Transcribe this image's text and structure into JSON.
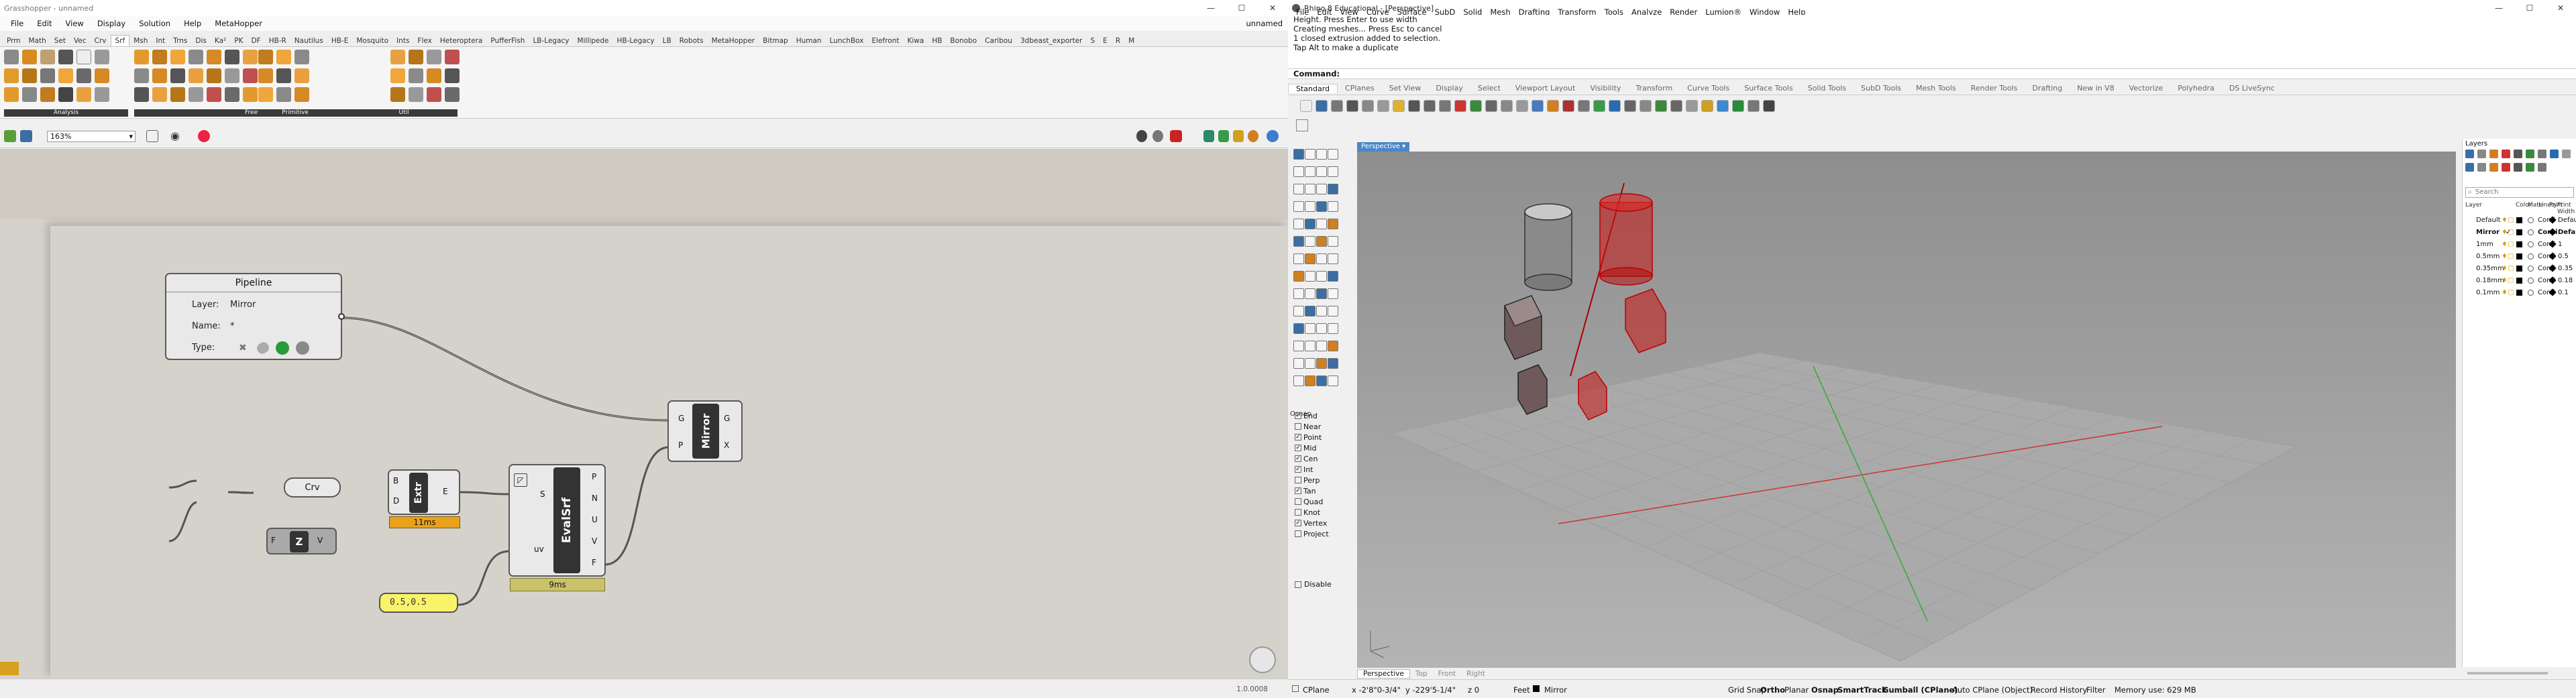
{
  "grasshopper": {
    "title": "Grasshopper - unnamed",
    "doc_name": "unnamed",
    "menu": [
      "File",
      "Edit",
      "View",
      "Display",
      "Solution",
      "Help",
      "MetaHopper"
    ],
    "tabs": [
      "Prm",
      "Math",
      "Set",
      "Vec",
      "Crv",
      "Srf",
      "Msh",
      "Int",
      "Trns",
      "Dis",
      "Ka²",
      "PK",
      "DF",
      "HB-R",
      "Nautilus",
      "HB-E",
      "Mosquito",
      "Ints",
      "Flex",
      "Heteroptera",
      "PufferFish",
      "LB-Legacy",
      "Millipede",
      "HB-Legacy",
      "LB",
      "Robots",
      "MetaHopper",
      "Bitmap",
      "Human",
      "LunchBox",
      "Elefront",
      "Kiwa",
      "HB",
      "Bonobo",
      "Caribou",
      "3dbeast_exporter",
      "S",
      "E",
      "R",
      "M"
    ],
    "active_tab": "Srf",
    "panel_labels": [
      "Analysis",
      "Freeform",
      "Primitive",
      "SubD",
      "Util"
    ],
    "zoom": "163%",
    "nodes": {
      "pipeline": {
        "title": "Pipeline",
        "layer_label": "Layer:",
        "layer_value": "Mirror",
        "name_label": "Name:",
        "name_value": "*",
        "type_label": "Type:"
      },
      "crv": {
        "label": "Crv"
      },
      "z": {
        "label": "Z",
        "in": "F",
        "out": "V"
      },
      "extr": {
        "label": "Extr",
        "in1": "B",
        "in2": "D",
        "out": "E",
        "timing": "11ms"
      },
      "evalsrf": {
        "label": "EvalSrf",
        "in1": "S",
        "in2": "uv",
        "outs": [
          "P",
          "N",
          "U",
          "V",
          "F"
        ],
        "timing": "9ms"
      },
      "mirror": {
        "label": "Mirror",
        "in1": "G",
        "in2": "P",
        "out1": "G",
        "out2": "X"
      },
      "panel": {
        "value": "0.5,0.5"
      }
    },
    "status_value": "1.0.0008"
  },
  "rhino": {
    "title": "Rhino 8 Educational - [Perspective]",
    "menu": [
      "File",
      "Edit",
      "View",
      "Curve",
      "Surface",
      "SubD",
      "Solid",
      "Mesh",
      "Drafting",
      "Transform",
      "Tools",
      "Analyze",
      "Render",
      "Lumion®",
      "Window",
      "Help"
    ],
    "history": [
      "Height. Press Enter to use width",
      "Creating meshes... Press Esc to cancel",
      "1 closed extrusion added to selection.",
      "Tap Alt to make a duplicate"
    ],
    "command_prompt": "Command:",
    "tabs": [
      "Standard",
      "CPlanes",
      "Set View",
      "Display",
      "Select",
      "Viewport Layout",
      "Visibility",
      "Transform",
      "Curve Tools",
      "Surface Tools",
      "Solid Tools",
      "SubD Tools",
      "Mesh Tools",
      "Render Tools",
      "Drafting",
      "New in V8",
      "Vectorize",
      "Polyhedra",
      "DS LiveSync"
    ],
    "active_tab": "Standard",
    "viewport_title": "Perspective",
    "view_tabs": [
      "Perspective",
      "Top",
      "Front",
      "Right"
    ],
    "active_view": "Perspective",
    "osnap": {
      "title": "Osnap",
      "items": [
        {
          "label": "End",
          "checked": true
        },
        {
          "label": "Near",
          "checked": false
        },
        {
          "label": "Point",
          "checked": true
        },
        {
          "label": "Mid",
          "checked": true
        },
        {
          "label": "Cen",
          "checked": true
        },
        {
          "label": "Int",
          "checked": true
        },
        {
          "label": "Perp",
          "checked": false
        },
        {
          "label": "Tan",
          "checked": true
        },
        {
          "label": "Quad",
          "checked": false
        },
        {
          "label": "Knot",
          "checked": false
        },
        {
          "label": "Vertex",
          "checked": true
        },
        {
          "label": "Project",
          "checked": false
        }
      ],
      "disable_label": "Disable"
    },
    "layers": {
      "title": "Layers",
      "search_placeholder": "Search",
      "headers": [
        "Layer",
        "Color",
        "Mate",
        "Linety",
        "Print",
        "Print Width"
      ],
      "rows": [
        {
          "name": "Default",
          "linetype": "Conti",
          "width": "Default",
          "current": false
        },
        {
          "name": "Mirror",
          "linetype": "Conti",
          "width": "Default",
          "current": true
        },
        {
          "name": "1mm",
          "linetype": "Conti",
          "width": "1",
          "current": false
        },
        {
          "name": "0.5mm",
          "linetype": "Conti",
          "width": "0.5",
          "current": false
        },
        {
          "name": "0.35mm",
          "linetype": "Conti",
          "width": "0.35",
          "current": false
        },
        {
          "name": "0.18mm",
          "linetype": "Conti",
          "width": "0.18",
          "current": false
        },
        {
          "name": "0.1mm",
          "linetype": "Conti",
          "width": "0.1",
          "current": false
        }
      ]
    },
    "status": {
      "cplane": "CPlane",
      "coords": "x -2'8\"0-3/4\"",
      "coords_y": "y -229'5-1/4\"",
      "coords_z": "z 0",
      "units": "Feet",
      "layer": "Mirror",
      "grid_snap": "Grid Snap",
      "ortho": "Ortho",
      "planar": "Planar",
      "osnap": "Osnap",
      "smarttrack": "SmartTrack",
      "gumball": "Gumball (CPlane)",
      "autocplane": "Auto CPlane (Object)",
      "record_history": "Record History",
      "filter": "Filter",
      "memory": "Memory use: 629 MB"
    }
  }
}
